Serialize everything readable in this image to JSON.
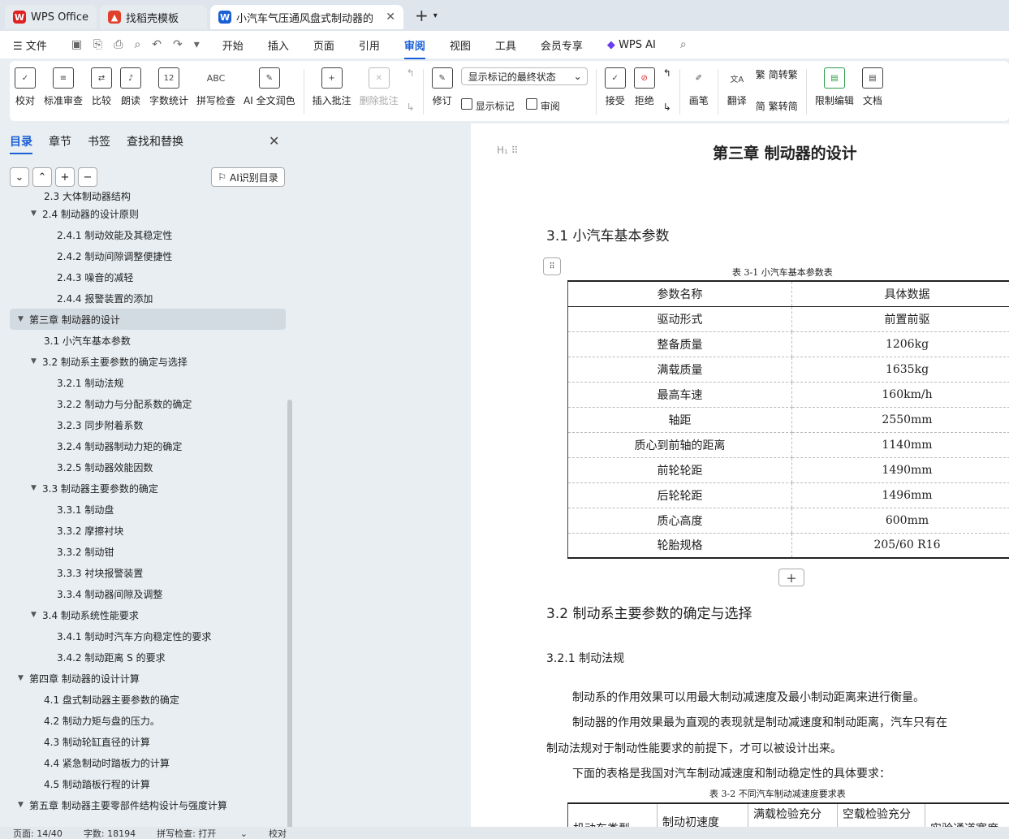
{
  "tabs": [
    {
      "label": "WPS Office",
      "color": "#e02020"
    },
    {
      "label": "找稻壳模板",
      "color": "#e0402a"
    },
    {
      "label": "小汽车气压通风盘式制动器的",
      "color": "#1a5fd6"
    }
  ],
  "menu": {
    "file": "文件",
    "items": [
      "开始",
      "插入",
      "页面",
      "引用",
      "审阅",
      "视图",
      "工具",
      "会员专享"
    ],
    "active": "审阅",
    "wpsai": "WPS AI"
  },
  "ribbon": {
    "proof": "校对",
    "standard_review": "标准审查",
    "compare": "比较",
    "read_aloud": "朗读",
    "word_count": "字数统计",
    "spell_check": "拼写检查",
    "ai_polish": "AI 全文润色",
    "insert_comment": "插入批注",
    "delete_comment": "删除批注",
    "revise": "修订",
    "show_markup_select": "显示标记的最终状态",
    "show_markup": "显示标记",
    "review": "审阅",
    "accept": "接受",
    "reject": "拒绝",
    "brush": "画笔",
    "translate": "翻译",
    "to_trad": "简转繁",
    "to_simp": "繁转简",
    "restrict_edit": "限制编辑",
    "doc": "文档"
  },
  "panel": {
    "tabs": [
      "目录",
      "章节",
      "书签",
      "查找和替换"
    ],
    "ai_toc": "AI识别目录",
    "toc": [
      {
        "label": "2.3 大体制动器结构",
        "level": 2,
        "arrow": ""
      },
      {
        "label": "2.4 制动器的设计原则",
        "level": 2,
        "arrow": "▼"
      },
      {
        "label": "2.4.1 制动效能及其稳定性",
        "level": 3,
        "arrow": ""
      },
      {
        "label": "2.4.2 制动间隙调整便捷性",
        "level": 3,
        "arrow": ""
      },
      {
        "label": "2.4.3 噪音的减轻",
        "level": 3,
        "arrow": ""
      },
      {
        "label": "2.4.4 报警装置的添加",
        "level": 3,
        "arrow": ""
      },
      {
        "label": "第三章 制动器的设计",
        "level": 1,
        "arrow": "▼",
        "selected": true
      },
      {
        "label": "3.1 小汽车基本参数",
        "level": 2,
        "arrow": ""
      },
      {
        "label": "3.2 制动系主要参数的确定与选择",
        "level": 2,
        "arrow": "▼"
      },
      {
        "label": "3.2.1 制动法规",
        "level": 3,
        "arrow": ""
      },
      {
        "label": "3.2.2 制动力与分配系数的确定",
        "level": 3,
        "arrow": ""
      },
      {
        "label": "3.2.3 同步附着系数",
        "level": 3,
        "arrow": ""
      },
      {
        "label": "3.2.4 制动器制动力矩的确定",
        "level": 3,
        "arrow": ""
      },
      {
        "label": "3.2.5 制动器效能因数",
        "level": 3,
        "arrow": ""
      },
      {
        "label": "3.3 制动器主要参数的确定",
        "level": 2,
        "arrow": "▼"
      },
      {
        "label": "3.3.1 制动盘",
        "level": 3,
        "arrow": ""
      },
      {
        "label": "3.3.2 摩擦衬块",
        "level": 3,
        "arrow": ""
      },
      {
        "label": "3.3.2 制动钳",
        "level": 3,
        "arrow": ""
      },
      {
        "label": "3.3.3 衬块报警装置",
        "level": 3,
        "arrow": ""
      },
      {
        "label": "3.3.4 制动器间隙及调整",
        "level": 3,
        "arrow": ""
      },
      {
        "label": "3.4 制动系统性能要求",
        "level": 2,
        "arrow": "▼"
      },
      {
        "label": "3.4.1 制动时汽车方向稳定性的要求",
        "level": 3,
        "arrow": ""
      },
      {
        "label": "3.4.2 制动距离 S 的要求",
        "level": 3,
        "arrow": ""
      },
      {
        "label": "第四章 制动器的设计计算",
        "level": 1,
        "arrow": "▼"
      },
      {
        "label": "4.1 盘式制动器主要参数的确定",
        "level": 2,
        "arrow": ""
      },
      {
        "label": "4.2 制动力矩与盘的压力。",
        "level": 2,
        "arrow": ""
      },
      {
        "label": "4.3 制动轮缸直径的计算",
        "level": 2,
        "arrow": ""
      },
      {
        "label": "4.4 紧急制动时踏板力的计算",
        "level": 2,
        "arrow": ""
      },
      {
        "label": "4.5 制动踏板行程的计算",
        "level": 2,
        "arrow": ""
      },
      {
        "label": "第五章 制动器主要零部件结构设计与强度计算",
        "level": 1,
        "arrow": "▼"
      }
    ]
  },
  "doc": {
    "chapter": "第三章 制动器的设计",
    "s31": "3.1 小汽车基本参数",
    "table1_caption": "表 3-1 小汽车基本参数表",
    "table1": [
      [
        "参数名称",
        "具体数据"
      ],
      [
        "驱动形式",
        "前置前驱"
      ],
      [
        "整备质量",
        "1206kg"
      ],
      [
        "满载质量",
        "1635kg"
      ],
      [
        "最高车速",
        "160km/h"
      ],
      [
        "轴距",
        "2550mm"
      ],
      [
        "质心到前轴的距离",
        "1140mm"
      ],
      [
        "前轮轮距",
        "1490mm"
      ],
      [
        "后轮轮距",
        "1496mm"
      ],
      [
        "质心高度",
        "600mm"
      ],
      [
        "轮胎规格",
        "205/60 R16"
      ]
    ],
    "s32": "3.2 制动系主要参数的确定与选择",
    "s321": "3.2.1 制动法规",
    "p1": "制动系的作用效果可以用最大制动减速度及最小制动距离来进行衡量。",
    "p2a": "制动器的作用效果最为直观的表现就是制动减速度和制动距离，汽车只有在",
    "p2b": "制动法规对于制动性能要求的前提下，才可以被设计出来。",
    "p3": "下面的表格是我国对汽车制动减速度和制动稳定性的具体要求：",
    "table2_caption": "表 3-2 不同汽车制动减速度要求表",
    "table2_head": [
      "机动车类型",
      "制动初速度",
      "满载检验充分",
      "空载检验充分",
      "实验通道宽度"
    ]
  },
  "status": {
    "page": "页面: 14/40",
    "words": "字数: 18194",
    "spell": "拼写检查: 打开",
    "proof": "校对"
  }
}
